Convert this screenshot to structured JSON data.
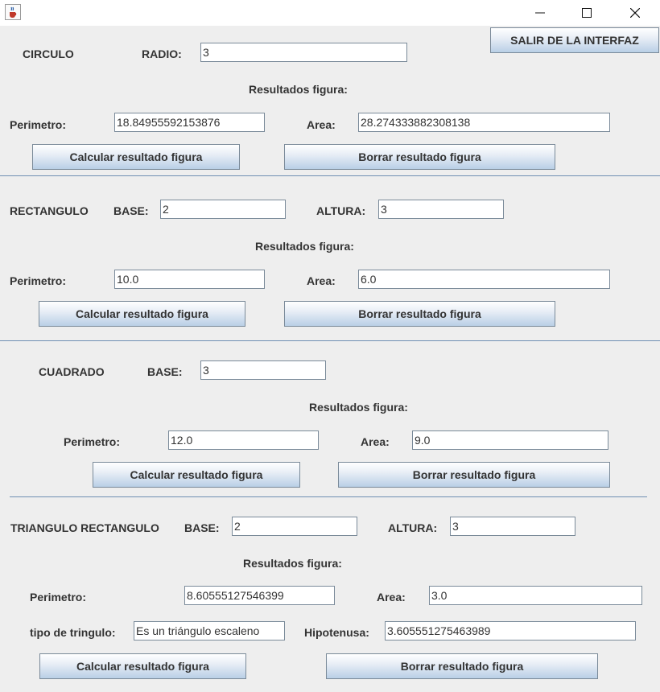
{
  "window": {
    "icon": "java-cup-icon",
    "controls": {
      "minimize": "minimize-icon",
      "maximize": "maximize-icon",
      "close": "close-icon"
    }
  },
  "exit_button": "SALIR DE LA INTERFAZ",
  "common": {
    "results_heading": "Resultados figura:",
    "perimeter_label": "Perimetro:",
    "area_label": "Area:",
    "calc_button": "Calcular resultado figura",
    "clear_button": "Borrar resultado figura"
  },
  "circle": {
    "title": "CIRCULO",
    "radius_label": "RADIO:",
    "radius_value": "3",
    "perimeter_value": "18.84955592153876",
    "area_value": "28.274333882308138"
  },
  "rectangle": {
    "title": "RECTANGULO",
    "base_label": "BASE:",
    "base_value": "2",
    "height_label": "ALTURA:",
    "height_value": "3",
    "perimeter_value": "10.0",
    "area_value": "6.0"
  },
  "square": {
    "title": "CUADRADO",
    "base_label": "BASE:",
    "base_value": "3",
    "perimeter_value": "12.0",
    "area_value": "9.0"
  },
  "triangle": {
    "title": "TRIANGULO RECTANGULO",
    "base_label": "BASE:",
    "base_value": "2",
    "height_label": "ALTURA:",
    "height_value": "3",
    "perimeter_value": "8.60555127546399",
    "area_value": "3.0",
    "type_label": "tipo de tringulo:",
    "type_value": "Es un triángulo escaleno",
    "hypotenuse_label": "Hipotenusa:",
    "hypotenuse_value": "3.605551275463989"
  },
  "colors": {
    "window_bg": "#eeeeee",
    "separator": "#6f8fb3",
    "button_gradient_end": "#b9cfe6"
  }
}
